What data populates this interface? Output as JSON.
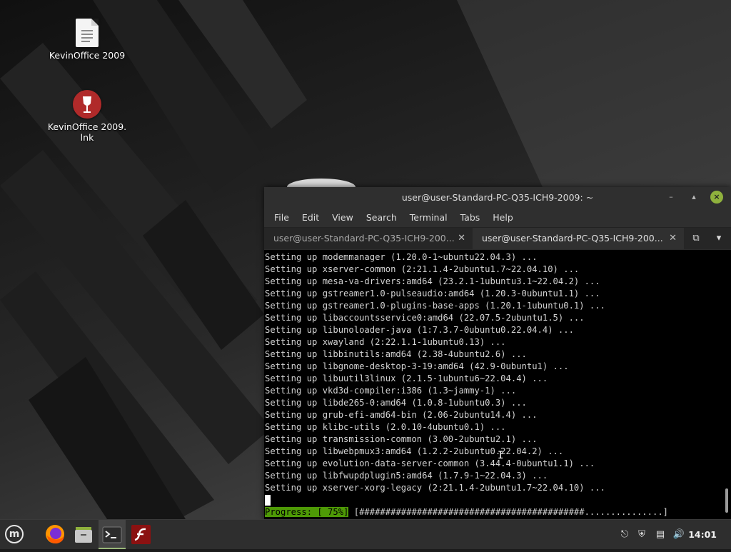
{
  "desktop": {
    "icons": [
      {
        "label": "KevinOffice 2009",
        "icon": "document-icon"
      },
      {
        "label": "KevinOffice 2009.\nlnk",
        "icon": "wine-icon"
      }
    ]
  },
  "terminal": {
    "title": "user@user-Standard-PC-Q35-ICH9-2009: ~",
    "menu": [
      "File",
      "Edit",
      "View",
      "Search",
      "Terminal",
      "Tabs",
      "Help"
    ],
    "tabs": [
      {
        "label": "user@user-Standard-PC-Q35-ICH9-200...",
        "active": false
      },
      {
        "label": "user@user-Standard-PC-Q35-ICH9-200...",
        "active": true
      }
    ],
    "lines": [
      "Setting up modemmanager (1.20.0-1~ubuntu22.04.3) ...",
      "Setting up xserver-common (2:21.1.4-2ubuntu1.7~22.04.10) ...",
      "Setting up mesa-va-drivers:amd64 (23.2.1-1ubuntu3.1~22.04.2) ...",
      "Setting up gstreamer1.0-pulseaudio:amd64 (1.20.3-0ubuntu1.1) ...",
      "Setting up gstreamer1.0-plugins-base-apps (1.20.1-1ubuntu0.1) ...",
      "Setting up libaccountsservice0:amd64 (22.07.5-2ubuntu1.5) ...",
      "Setting up libunoloader-java (1:7.3.7-0ubuntu0.22.04.4) ...",
      "Setting up xwayland (2:22.1.1-1ubuntu0.13) ...",
      "Setting up libbinutils:amd64 (2.38-4ubuntu2.6) ...",
      "Setting up libgnome-desktop-3-19:amd64 (42.9-0ubuntu1) ...",
      "Setting up libuutil3linux (2.1.5-1ubuntu6~22.04.4) ...",
      "Setting up vkd3d-compiler:i386 (1.3~jammy-1) ...",
      "Setting up libde265-0:amd64 (1.0.8-1ubuntu0.3) ...",
      "Setting up grub-efi-amd64-bin (2.06-2ubuntu14.4) ...",
      "Setting up klibc-utils (2.0.10-4ubuntu0.1) ...",
      "Setting up transmission-common (3.00-2ubuntu2.1) ...",
      "Setting up libwebpmux3:amd64 (1.2.2-2ubuntu0.22.04.2) ...",
      "Setting up evolution-data-server-common (3.44.4-0ubuntu1.1) ...",
      "Setting up libfwupdplugin5:amd64 (1.7.9-1~22.04.3) ...",
      "Setting up xserver-xorg-legacy (2:21.1.4-2ubuntu1.7~22.04.10) ..."
    ],
    "progress": {
      "label": "Progress: [ 75%]",
      "percent": 75,
      "bar": "[###########################################...............]"
    }
  },
  "taskbar": {
    "apps": [
      "menu-icon",
      "firefox-icon",
      "files-icon",
      "terminal-icon",
      "flash-icon"
    ],
    "tray": [
      "update-icon",
      "shield-icon",
      "network-icon",
      "volume-icon"
    ],
    "clock": "14:01"
  },
  "colors": {
    "progress_bg": "#4e9a06",
    "close_button": "#8fb13d"
  }
}
